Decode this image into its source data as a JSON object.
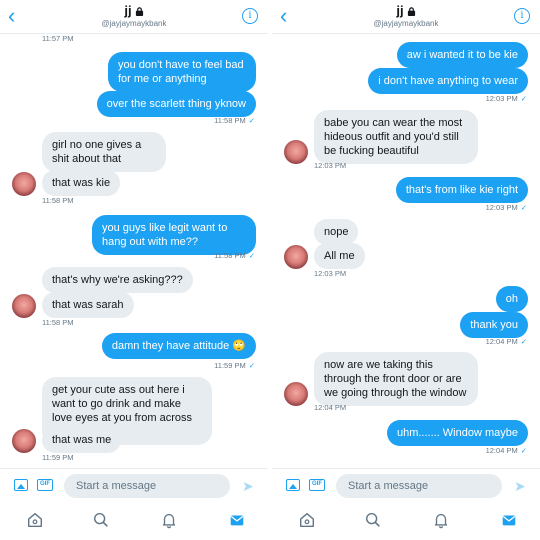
{
  "colors": {
    "accent": "#1da1f2",
    "incoming_bubble": "#e6ecf0",
    "muted_text": "#657786"
  },
  "panels": [
    {
      "id": "left",
      "header": {
        "back_icon": "chevron-left-icon",
        "title": "jj",
        "title_badge_icon": "lock-icon",
        "handle": "@jayjaymaykbank",
        "info_icon": "info-icon"
      },
      "composer": {
        "placeholder": "Start a message"
      },
      "tabs": [
        "home-icon",
        "search-icon",
        "notifications-icon",
        "messages-icon"
      ],
      "messages": [
        {
          "type": "ts",
          "side": "in",
          "text": "11:57 PM"
        },
        {
          "type": "msg",
          "side": "out",
          "text": "you don't have to feel bad for me or anything"
        },
        {
          "type": "msg",
          "side": "out",
          "text": "over the scarlett thing yknow"
        },
        {
          "type": "ts",
          "side": "out",
          "text": "11:58 PM",
          "check": "✓"
        },
        {
          "type": "msg",
          "side": "in",
          "text": "girl no one gives a shit about that"
        },
        {
          "type": "msg",
          "side": "in",
          "text": "that was kie",
          "avatar": true
        },
        {
          "type": "ts",
          "side": "in",
          "text": "11:58 PM"
        },
        {
          "type": "msg",
          "side": "out",
          "text": "you guys like legit want to hang out with me??"
        },
        {
          "type": "ts",
          "side": "out",
          "text": "11:58 PM",
          "check": "✓"
        },
        {
          "type": "msg",
          "side": "in",
          "text": "that's why we're asking???"
        },
        {
          "type": "msg",
          "side": "in",
          "text": "that was sarah",
          "avatar": true
        },
        {
          "type": "ts",
          "side": "in",
          "text": "11:58 PM"
        },
        {
          "type": "msg",
          "side": "out",
          "text": "damn they have attitude 🙄"
        },
        {
          "type": "ts",
          "side": "out",
          "text": "11:59 PM",
          "check": "✓"
        },
        {
          "type": "msg",
          "side": "in",
          "text": "get your cute ass out here i want to go drink and make love eyes at you from across the bonfire"
        },
        {
          "type": "msg",
          "side": "in",
          "text": "that was me",
          "avatar": true
        },
        {
          "type": "ts",
          "side": "in",
          "text": "11:59 PM"
        }
      ]
    },
    {
      "id": "right",
      "header": {
        "back_icon": "chevron-left-icon",
        "title": "jj",
        "title_badge_icon": "lock-icon",
        "handle": "@jayjaymaykbank",
        "info_icon": "info-icon"
      },
      "composer": {
        "placeholder": "Start a message"
      },
      "tabs": [
        "home-icon",
        "search-icon",
        "notifications-icon",
        "messages-icon"
      ],
      "messages": [
        {
          "type": "msg",
          "side": "out",
          "text": "aw i wanted it to be kie"
        },
        {
          "type": "msg",
          "side": "out",
          "text": "i don't have anything to wear"
        },
        {
          "type": "ts",
          "side": "out",
          "text": "12:03 PM",
          "check": "✓"
        },
        {
          "type": "msg",
          "side": "in",
          "text": "babe you can wear the most hideous outfit and you'd still be fucking beautiful",
          "avatar": true
        },
        {
          "type": "ts",
          "side": "in",
          "text": "12:03 PM"
        },
        {
          "type": "msg",
          "side": "out",
          "text": "that's from like kie right"
        },
        {
          "type": "ts",
          "side": "out",
          "text": "12:03 PM",
          "check": "✓"
        },
        {
          "type": "msg",
          "side": "in",
          "text": "nope"
        },
        {
          "type": "msg",
          "side": "in",
          "text": "All me",
          "avatar": true
        },
        {
          "type": "ts",
          "side": "in",
          "text": "12:03 PM"
        },
        {
          "type": "msg",
          "side": "out",
          "text": "oh"
        },
        {
          "type": "msg",
          "side": "out",
          "text": "thank you"
        },
        {
          "type": "ts",
          "side": "out",
          "text": "12:04 PM",
          "check": "✓"
        },
        {
          "type": "msg",
          "side": "in",
          "text": "now are we taking this through the front door or are we going through the window",
          "avatar": true
        },
        {
          "type": "ts",
          "side": "in",
          "text": "12:04 PM"
        },
        {
          "type": "msg",
          "side": "out",
          "text": "uhm....... Window maybe"
        },
        {
          "type": "ts",
          "side": "out",
          "text": "12:04 PM",
          "check": "✓"
        }
      ]
    }
  ]
}
